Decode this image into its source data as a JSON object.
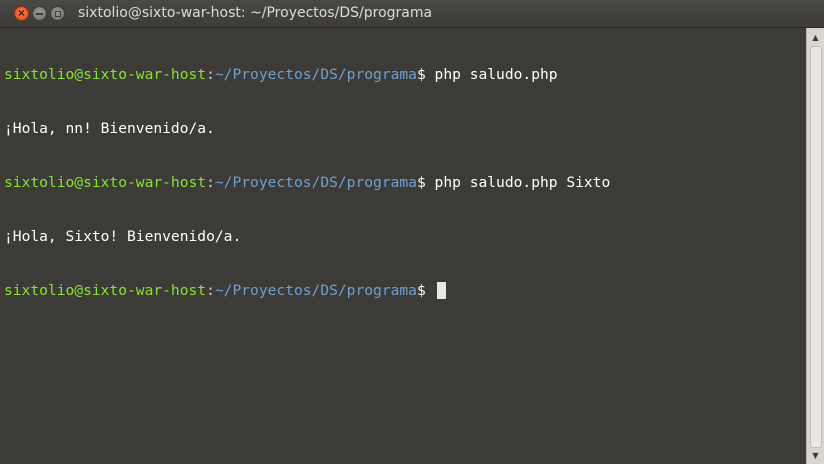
{
  "window": {
    "title": "sixtolio@sixto-war-host: ~/Proyectos/DS/programa",
    "close_glyph": "×"
  },
  "terminal": {
    "lines": [
      {
        "user": "sixtolio@sixto-war-host",
        "sep": ":",
        "path": "~/Proyectos/DS/programa",
        "command": "$ php saludo.php"
      },
      {
        "output": "¡Hola, nn! Bienvenido/a."
      },
      {
        "user": "sixtolio@sixto-war-host",
        "sep": ":",
        "path": "~/Proyectos/DS/programa",
        "command": "$ php saludo.php Sixto"
      },
      {
        "output": "¡Hola, Sixto! Bienvenido/a."
      },
      {
        "user": "sixtolio@sixto-war-host",
        "sep": ":",
        "path": "~/Proyectos/DS/programa",
        "command": "$ "
      }
    ]
  },
  "scrollbar": {
    "up_glyph": "▲",
    "down_glyph": "▼"
  },
  "colors": {
    "background": "#3c3b37",
    "user": "#8ae234",
    "path": "#729fcf",
    "text": "#ffffff",
    "close_button": "#df4a16"
  },
  "icons": {
    "close": "close-icon",
    "minimize": "minimize-icon",
    "maximize": "maximize-icon",
    "scroll_up": "scroll-up-arrow-icon",
    "scroll_down": "scroll-down-arrow-icon"
  }
}
